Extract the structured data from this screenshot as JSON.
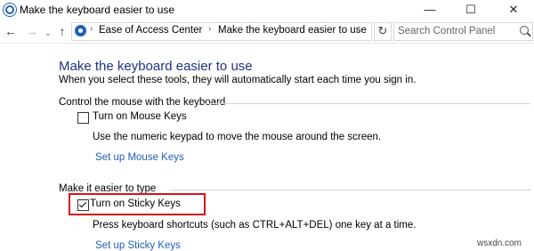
{
  "window": {
    "title": "Make the keyboard easier to use",
    "controls": {
      "minimize": "—",
      "maximize": "☐",
      "close": "✕"
    }
  },
  "addressbar": {
    "back": "←",
    "forward": "→",
    "dropdown": "⌄",
    "up": "↑",
    "breadcrumbs": [
      "Ease of Access Center",
      "Make the keyboard easier to use"
    ],
    "separator": "›",
    "refresh": "↻",
    "search_placeholder": "Search Control Panel"
  },
  "page": {
    "title": "Make the keyboard easier to use",
    "subtitle": "When you select these tools, they will automatically start each time you sign in."
  },
  "sections": {
    "mouse": {
      "heading": "Control the mouse with the keyboard",
      "checkbox_label": "Turn on Mouse Keys",
      "checked": false,
      "description": "Use the numeric keypad to move the mouse around the screen.",
      "link": "Set up Mouse Keys"
    },
    "typing": {
      "heading": "Make it easier to type",
      "checkbox_label": "Turn on Sticky Keys",
      "checked": true,
      "description": "Press keyboard shortcuts (such as CTRL+ALT+DEL) one key at a time.",
      "link": "Set up Sticky Keys"
    }
  },
  "colors": {
    "title_blue": "#1e3287",
    "link_blue": "#1f5fb8",
    "highlight_red": "#d8131e"
  },
  "watermark": "wsxdn.com"
}
